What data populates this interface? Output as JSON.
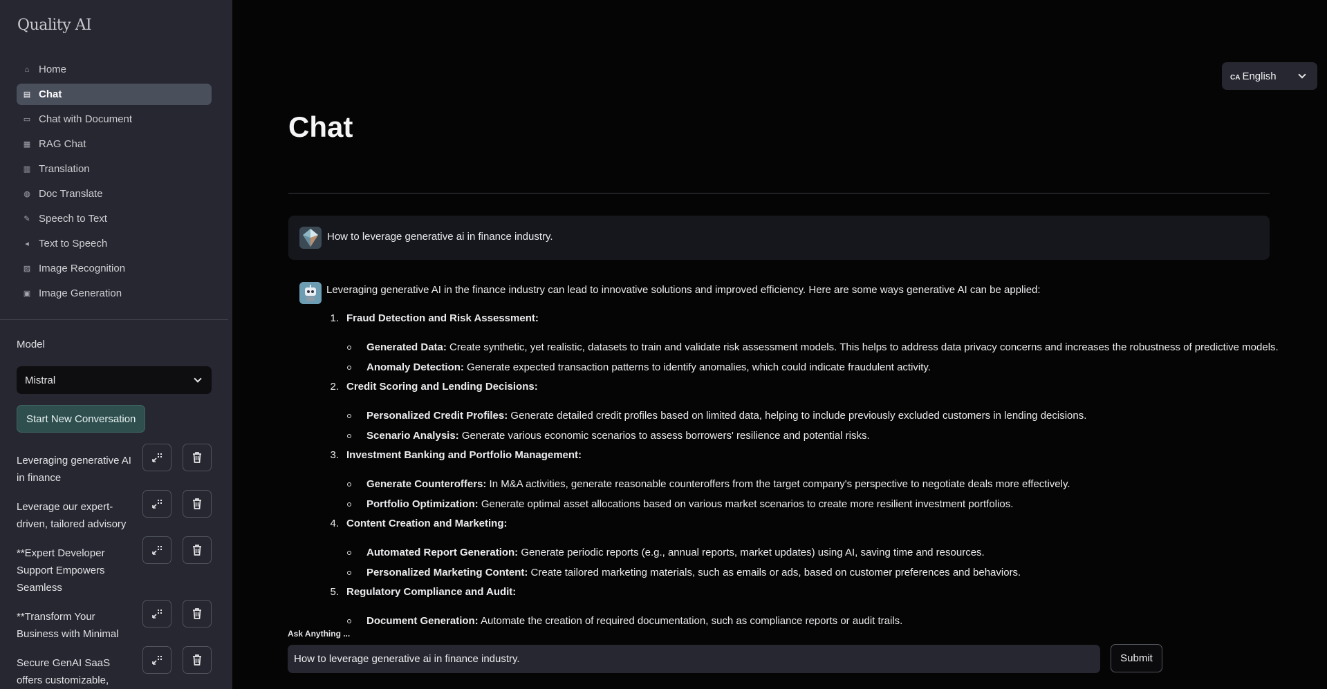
{
  "brand": "Quality AI",
  "nav": [
    {
      "label": "Home",
      "icon": "home-icon",
      "glyph": "⌂",
      "active": false
    },
    {
      "label": "Chat",
      "icon": "chat-icon",
      "glyph": "▤",
      "active": true
    },
    {
      "label": "Chat with Document",
      "icon": "chat-document-icon",
      "glyph": "▭",
      "active": false
    },
    {
      "label": "RAG Chat",
      "icon": "rag-icon",
      "glyph": "▦",
      "active": false
    },
    {
      "label": "Translation",
      "icon": "translate-icon",
      "glyph": "▥",
      "active": false
    },
    {
      "label": "Doc Translate",
      "icon": "doc-translate-icon",
      "glyph": "◍",
      "active": false
    },
    {
      "label": "Speech to Text",
      "icon": "speech-to-text-icon",
      "glyph": "✎",
      "active": false
    },
    {
      "label": "Text to Speech",
      "icon": "speaker-icon",
      "glyph": "◂",
      "active": false
    },
    {
      "label": "Image Recognition",
      "icon": "image-recognition-icon",
      "glyph": "▨",
      "active": false
    },
    {
      "label": "Image Generation",
      "icon": "image-generation-icon",
      "glyph": "▣",
      "active": false
    }
  ],
  "model": {
    "label": "Model",
    "selected": "Mistral"
  },
  "new_conversation": "Start New Conversation",
  "conversations": [
    "Leveraging generative AI in finance",
    "Leverage our expert-driven, tailored advisory",
    "**Expert Developer Support Empowers Seamless",
    "**Transform Your Business with Minimal",
    "Secure GenAI SaaS offers customizable,"
  ],
  "language": {
    "flag": "CA",
    "label": "English"
  },
  "page_title": "Chat",
  "user_message": "How to leverage generative ai in finance industry.",
  "answer": {
    "intro": "Leveraging generative AI in the finance industry can lead to innovative solutions and improved efficiency. Here are some ways generative AI can be applied:",
    "sections": [
      {
        "num": "1.",
        "title": "Fraud Detection and Risk Assessment:",
        "bullets": [
          {
            "bold": "Generated Data:",
            "text": " Create synthetic, yet realistic, datasets to train and validate risk assessment models. This helps to address data privacy concerns and increases the robustness of predictive models."
          },
          {
            "bold": "Anomaly Detection:",
            "text": " Generate expected transaction patterns to identify anomalies, which could indicate fraudulent activity."
          }
        ]
      },
      {
        "num": "2.",
        "title": "Credit Scoring and Lending Decisions:",
        "bullets": [
          {
            "bold": "Personalized Credit Profiles:",
            "text": " Generate detailed credit profiles based on limited data, helping to include previously excluded customers in lending decisions."
          },
          {
            "bold": "Scenario Analysis:",
            "text": " Generate various economic scenarios to assess borrowers' resilience and potential risks."
          }
        ]
      },
      {
        "num": "3.",
        "title": "Investment Banking and Portfolio Management:",
        "bullets": [
          {
            "bold": "Generate Counteroffers:",
            "text": " In M&A activities, generate reasonable counteroffers from the target company's perspective to negotiate deals more effectively."
          },
          {
            "bold": "Portfolio Optimization:",
            "text": " Generate optimal asset allocations based on various market scenarios to create more resilient investment portfolios."
          }
        ]
      },
      {
        "num": "4.",
        "title": "Content Creation and Marketing:",
        "bullets": [
          {
            "bold": "Automated Report Generation:",
            "text": " Generate periodic reports (e.g., annual reports, market updates) using AI, saving time and resources."
          },
          {
            "bold": "Personalized Marketing Content:",
            "text": " Create tailored marketing materials, such as emails or ads, based on customer preferences and behaviors."
          }
        ]
      },
      {
        "num": "5.",
        "title": "Regulatory Compliance and Audit:",
        "bullets": [
          {
            "bold": "Document Generation:",
            "text": " Automate the creation of required documentation, such as compliance reports or audit trails."
          }
        ]
      }
    ]
  },
  "input": {
    "label": "Ask Anything ...",
    "value": "How to leverage generative ai in finance industry."
  },
  "submit": "Submit"
}
